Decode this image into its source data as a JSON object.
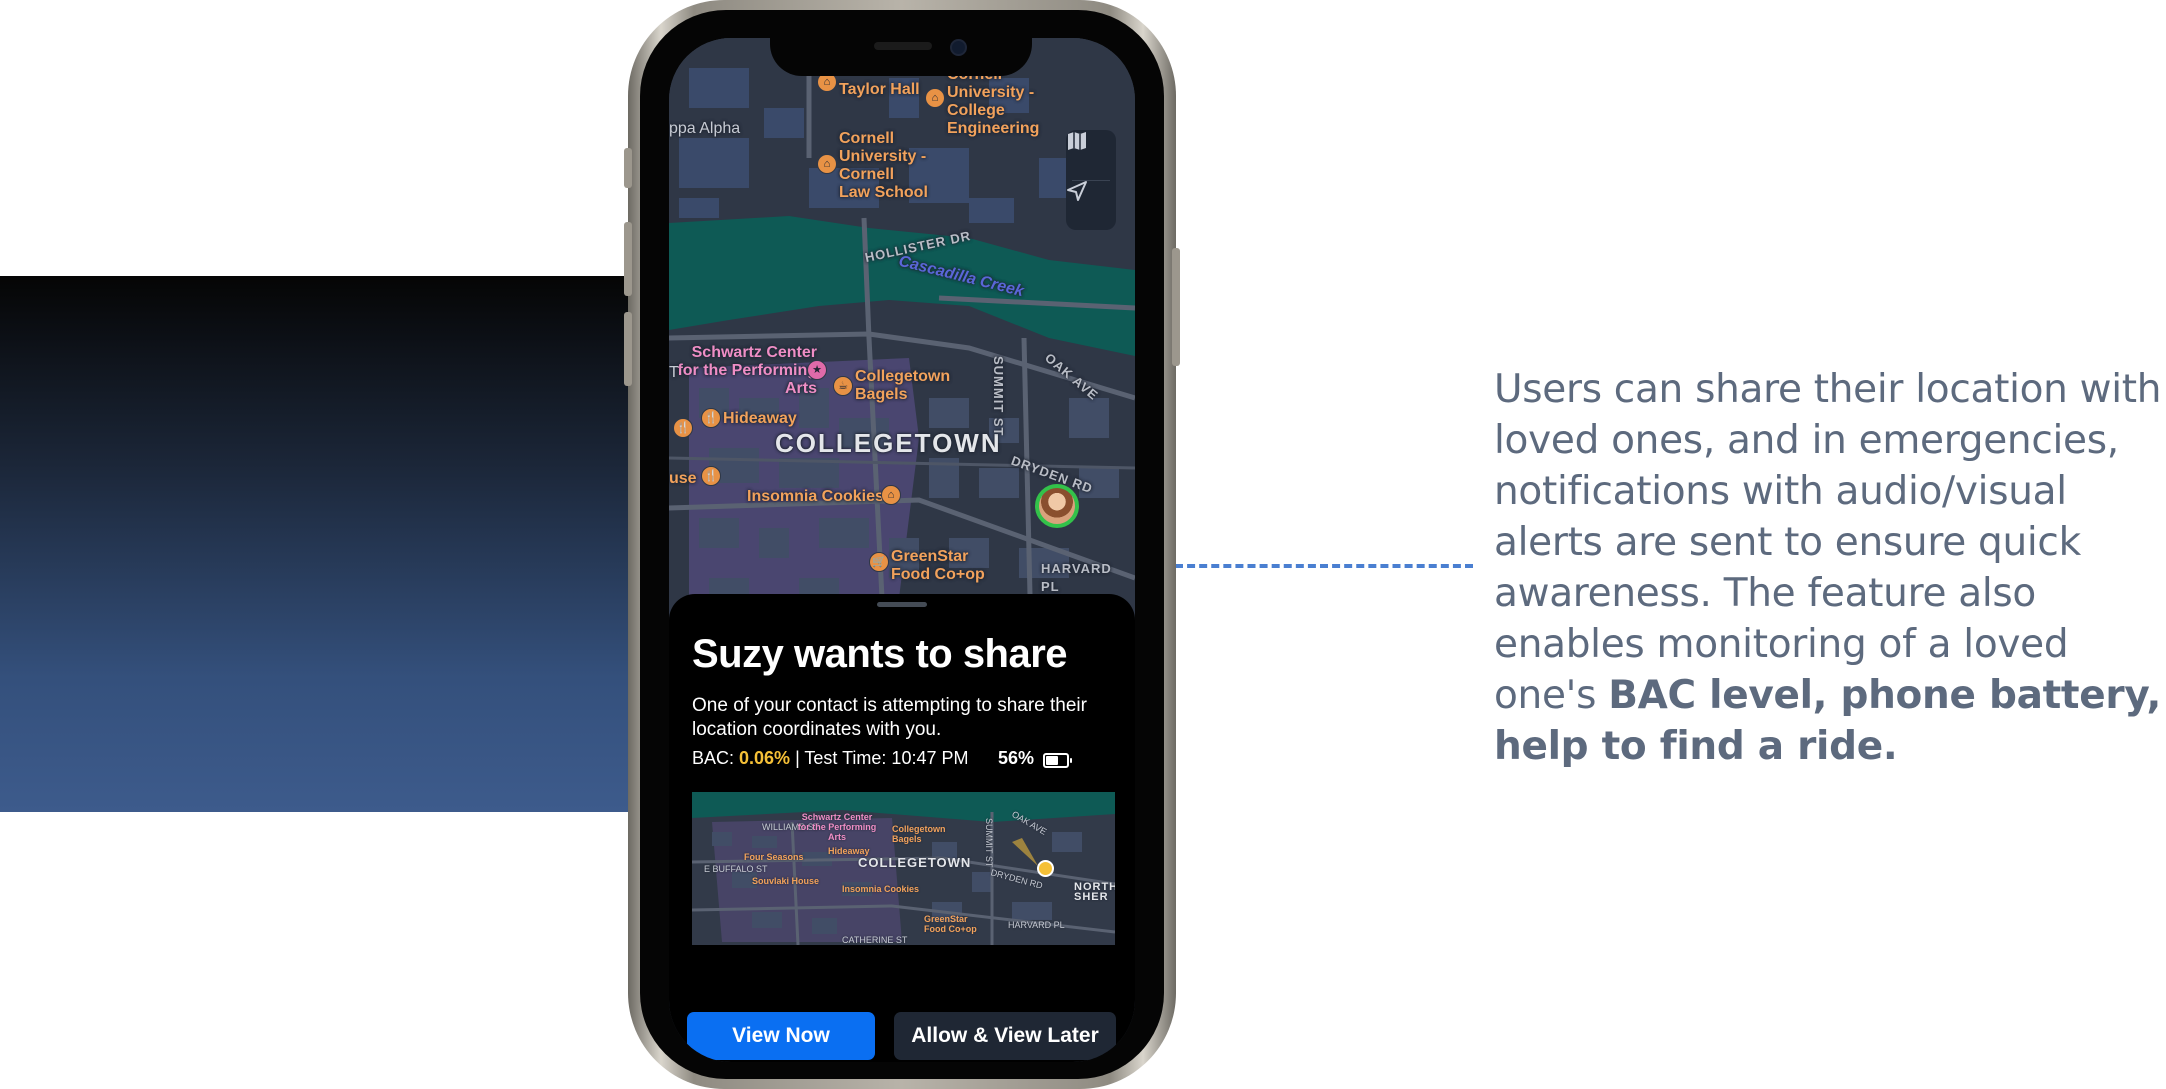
{
  "description": {
    "text_plain": "Users can share their location with loved ones, and in emergencies, notifications with audio/visual alerts are sent to ensure quick awareness. The feature also enables monitoring of a loved one's ",
    "text_bold": "BAC level, phone battery, help to find a ride."
  },
  "map": {
    "labels": {
      "taylor_hall": "Taylor Hall",
      "college_eng": "Cornell University - College Engineering",
      "kappa_alpha": "ppa Alpha",
      "law_school": "Cornell University - Cornell Law School",
      "hollister": "HOLLISTER DR",
      "creek": "Cascadilla Creek",
      "schwartz": "Schwartz Center for the Performing Arts",
      "bagels": "Collegetown Bagels",
      "hideaway": "Hideaway",
      "collegetown": "COLLEGETOWN",
      "summit": "SUMMIT ST",
      "oak": "OAK AVE",
      "house": "use",
      "insomnia": "Insomnia Cookies",
      "dryden": "DRYDEN RD",
      "greenstar": "GreenStar Food Co+op",
      "harvard": "HARVARD PL",
      "t": "T"
    }
  },
  "sheet": {
    "title": "Suzy wants to share",
    "body": "One of your contact is attempting to share their location coordinates with you.",
    "bac_label": "BAC: ",
    "bac_value": "0.06%",
    "test_time": " | Test Time: 10:47 PM",
    "battery_pct": "56%",
    "battery_level": 0.56,
    "mini_map": {
      "williams": "WILLIAMS ST",
      "schwartz": "Schwartz Center for the Performing Arts",
      "bagels": "Collegetown Bagels",
      "summit": "SUMMIT ST",
      "oak": "OAK AVE",
      "four_seasons": "Four Seasons",
      "hideaway": "Hideaway",
      "buffalo": "E BUFFALO ST",
      "collegetown": "COLLEGETOWN",
      "dryden": "DRYDEN RD",
      "souvlaki": "Souvlaki House",
      "north": "NORTH SHER",
      "insomnia": "Insomnia Cookies",
      "greenstar": "GreenStar Food Co+op",
      "harvard": "HARVARD PL",
      "catherine": "CATHERINE ST"
    },
    "view_now": "View Now",
    "allow_later": "Allow & View Later"
  }
}
